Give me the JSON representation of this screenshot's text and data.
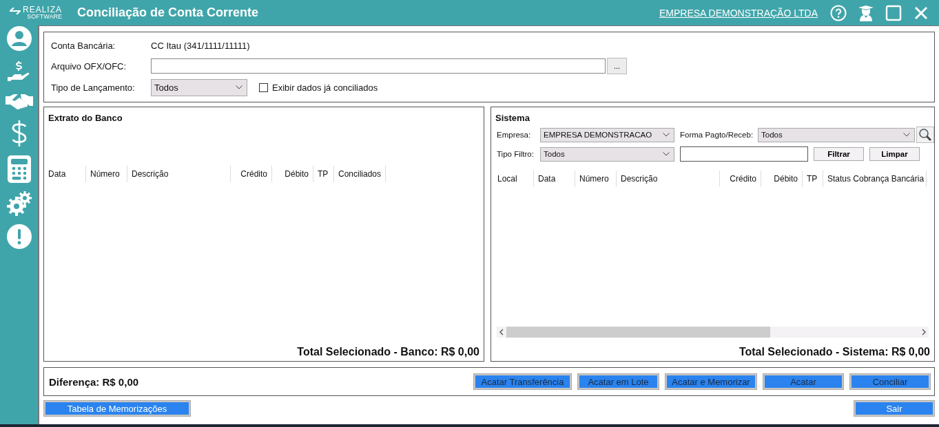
{
  "logo": {
    "name": "REALIZA",
    "sub": "SOFTWARE"
  },
  "window": {
    "title": "Conciliação de Conta Corrente",
    "company_link": "EMPRESA DEMONSTRAÇÃO LTDA"
  },
  "header_form": {
    "account_label": "Conta Bancária:",
    "account_value": "CC Itau (341/1111/11111)",
    "file_label": "Arquivo OFX/OFC:",
    "browse_button": "...",
    "type_label": "Tipo de Lançamento:",
    "type_value": "Todos",
    "show_reconciled": {
      "label": "Exibir dados já conciliados",
      "checked": false
    }
  },
  "bank_panel": {
    "title": "Extrato do Banco",
    "columns": [
      {
        "label": "Data"
      },
      {
        "label": "Número"
      },
      {
        "label": "Descrição"
      },
      {
        "label": "Crédito"
      },
      {
        "label": "Débito"
      },
      {
        "label": "TP"
      },
      {
        "label": "Conciliados"
      }
    ],
    "total": "Total Selecionado - Banco: R$ 0,00"
  },
  "system_panel": {
    "title": "Sistema",
    "company_label": "Empresa:",
    "company_value": "EMPRESA DEMONSTRACAO",
    "payment_label": "Forma Pagto/Receb:",
    "payment_value": "Todos",
    "filter_type_label": "Tipo Filtro:",
    "filter_type_value": "Todos",
    "filter_button": "Filtrar",
    "clear_button": "Limpar",
    "columns": [
      {
        "label": "Local"
      },
      {
        "label": "Data"
      },
      {
        "label": "Número"
      },
      {
        "label": "Descrição"
      },
      {
        "label": "Crédito"
      },
      {
        "label": "Débito"
      },
      {
        "label": "TP"
      },
      {
        "label": "Status Cobrança Bancária"
      }
    ],
    "total": "Total Selecionado - Sistema: R$ 0,00"
  },
  "difference": "Diferença: R$ 0,00",
  "action_buttons": [
    "Acatar Transferência",
    "Acatar em Lote",
    "Acatar e Memorizar",
    "Acatar",
    "Conciliar"
  ],
  "memorizations_button": "Tabela de Memorizações",
  "exit_button": "Sair"
}
